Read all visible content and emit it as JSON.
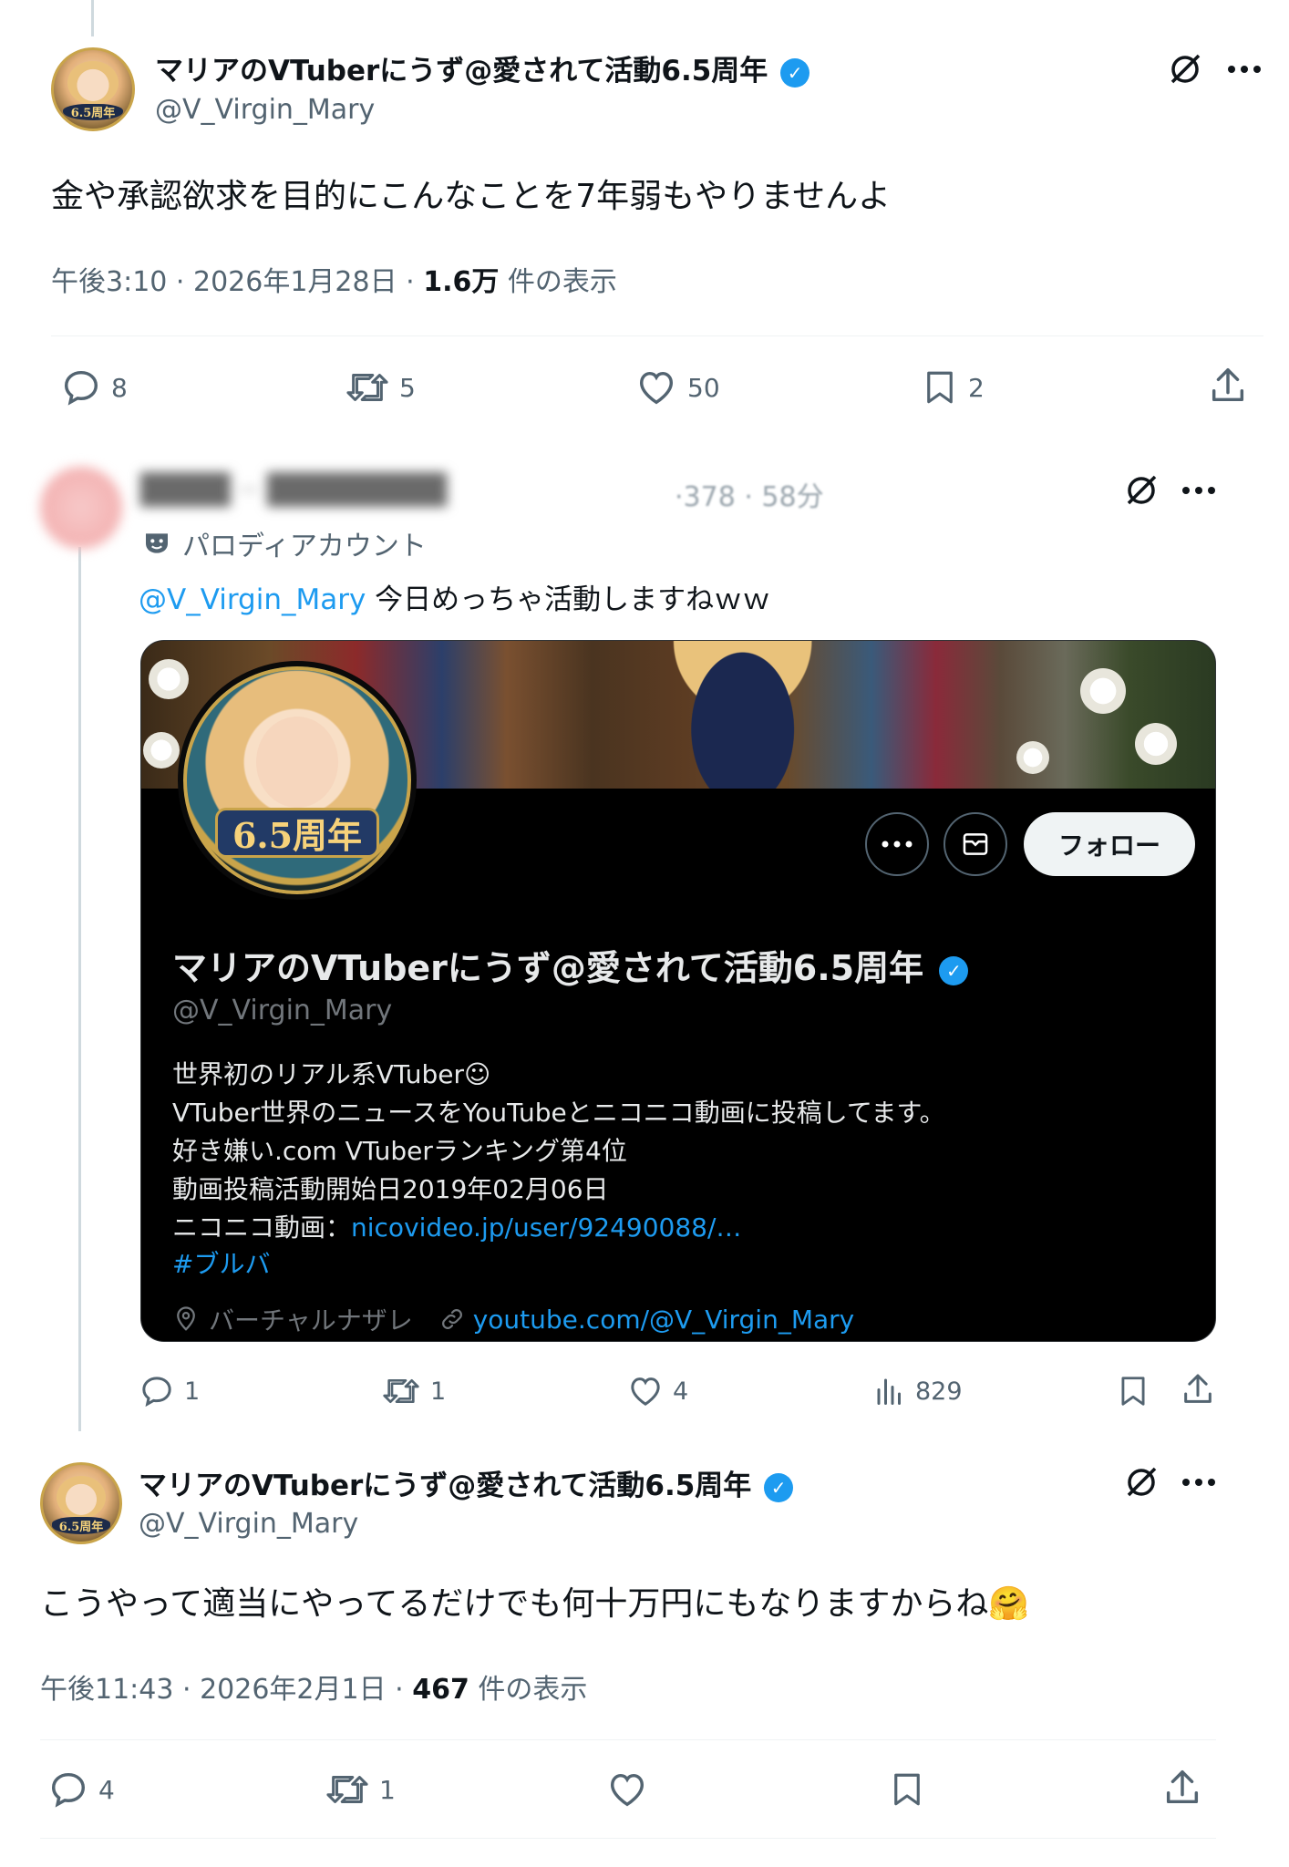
{
  "tweet1": {
    "name": "マリアのVTuberにうず@愛されて活動6.5周年",
    "handle": "@V_Virgin_Mary",
    "avatar_badge": "6.5周年",
    "text": "金や承認欲求を目的にこんなことを7年弱もやりませんよ",
    "time": "午後3:10 · 2026年1月28日 · ",
    "views": "1.6万",
    "views_label": " 件の表示",
    "replies": "8",
    "retweets": "5",
    "likes": "50",
    "bookmarks": "2"
  },
  "reply": {
    "name_blurred": "████ ·· ████████",
    "time_blurred": "·378 · 58分",
    "parody_label": "パロディアカウント",
    "mention": "@V_Virgin_Mary",
    "text": " 今日めっちゃ活動しますねｗｗ",
    "replies": "1",
    "retweets": "1",
    "likes": "4",
    "views": "829"
  },
  "card": {
    "avatar_badge": "6.5周年",
    "follow_label": "フォロー",
    "name": "マリアのVTuberにうず@愛されて活動6.5周年",
    "handle": "@V_Virgin_Mary",
    "bio_line1": "世界初のリアル系VTuber☺",
    "bio_line2": "VTuber世界のニュースをYouTubeとニコニコ動画に投稿してます。",
    "bio_line3": "好き嫌い.com VTuberランキング第4位",
    "bio_line4": "動画投稿活動開始日2019年02月06日",
    "bio_line5_prefix": "ニコニコ動画：",
    "bio_line5_link": "nicovideo.jp/user/92490088/…",
    "bio_hashtag": "#ブルバ",
    "location": "バーチャルナザレ",
    "website": "youtube.com/@V_Virgin_Mary"
  },
  "tweet3": {
    "name": "マリアのVTuberにうず@愛されて活動6.5周年",
    "handle": "@V_Virgin_Mary",
    "avatar_badge": "6.5周年",
    "text": "こうやって適当にやってるだけでも何十万円にもなりますからね🤗",
    "time": "午後11:43 · 2026年2月1日 · ",
    "views": "467",
    "views_label": " 件の表示",
    "replies": "4",
    "retweets": "1"
  },
  "colors": {
    "accent": "#1d9bf0",
    "muted": "#536471",
    "text": "#0f1419"
  },
  "icons": [
    "grok-icon",
    "more-icon",
    "reply-icon",
    "retweet-icon",
    "like-icon",
    "bookmark-icon",
    "share-icon",
    "views-icon",
    "mail-icon",
    "location-icon",
    "link-icon",
    "parody-mask-icon",
    "verified-icon"
  ]
}
